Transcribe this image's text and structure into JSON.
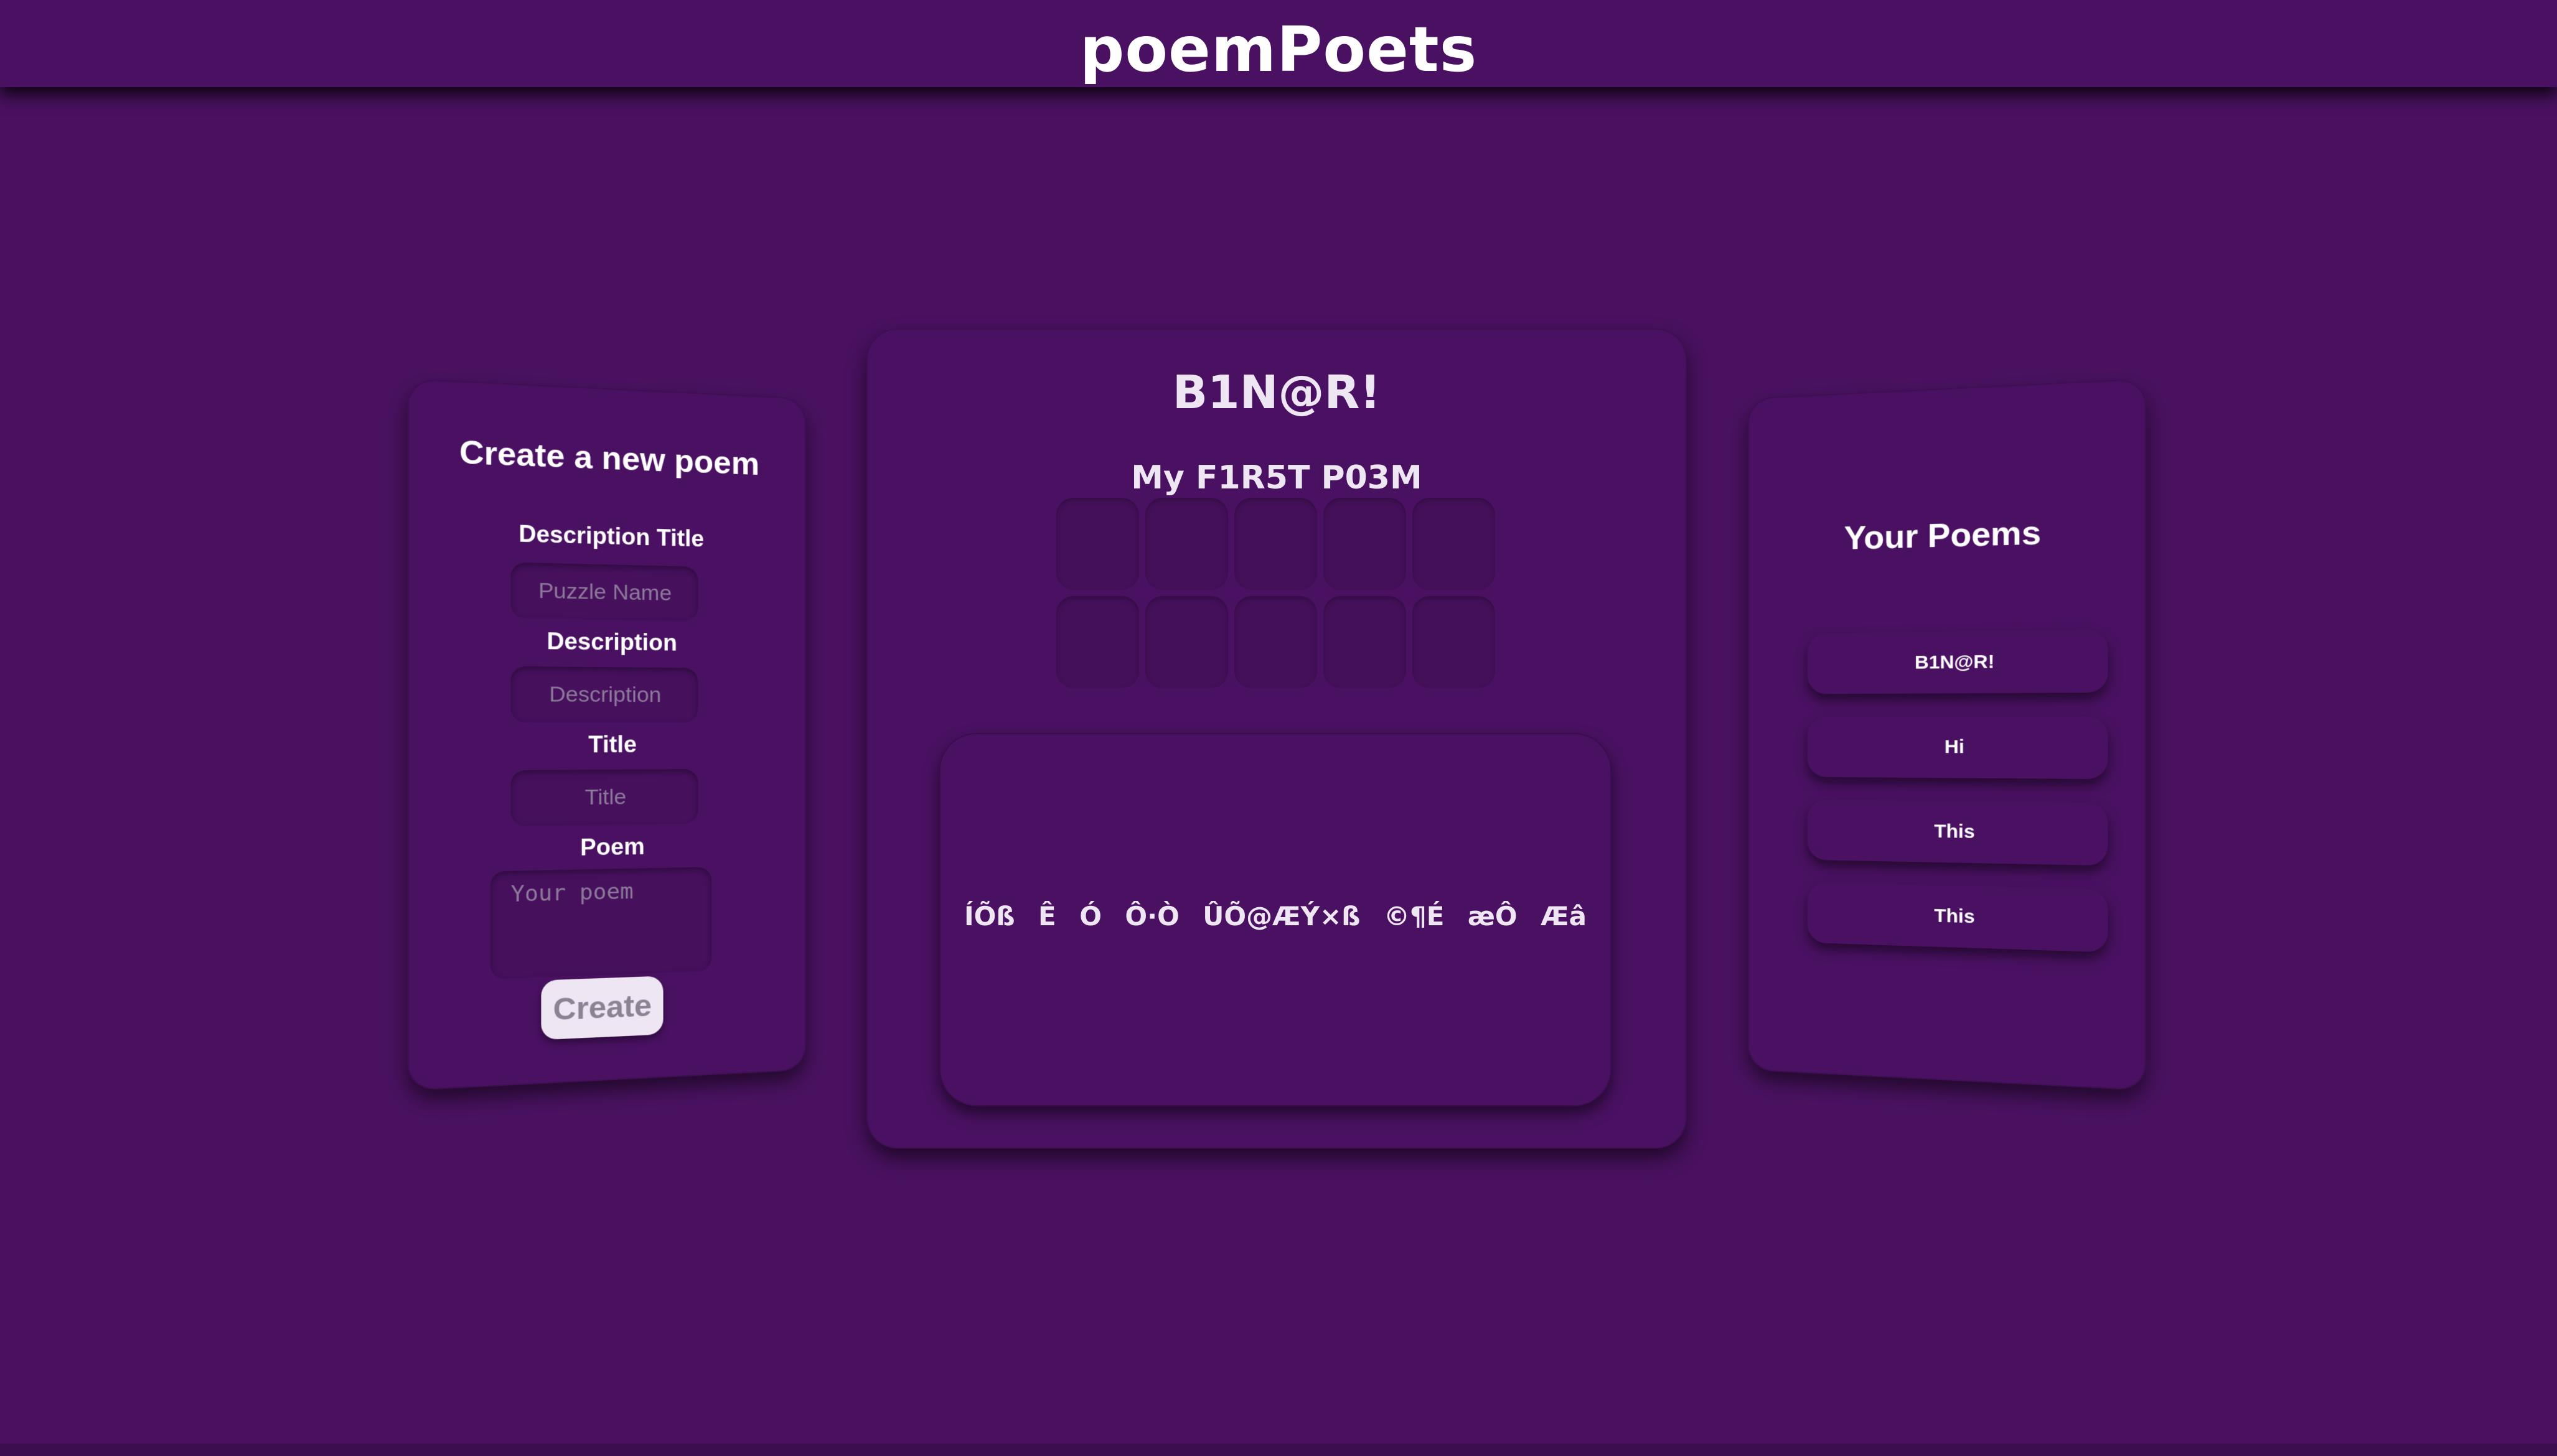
{
  "app": {
    "title": "poemPoets"
  },
  "create_form": {
    "heading": "Create a new poem",
    "description_title_label": "Description Title",
    "description_title_placeholder": "Puzzle Name",
    "description_label": "Description",
    "description_placeholder": "Description",
    "title_label": "Title",
    "title_placeholder": "Title",
    "poem_label": "Poem",
    "poem_placeholder": "Your poem",
    "create_button": "Create"
  },
  "puzzle": {
    "title": "B1N@R!",
    "description": "My F1R5T P03M",
    "grid_rows": 2,
    "grid_cols": 5,
    "poem_words": [
      "ÍÕß",
      "Ê",
      "Ó",
      "Ô·Ò",
      "ÛÕ@ÆÝ×ß",
      "©¶É",
      "æÔ",
      "Æâ"
    ]
  },
  "your_poems": {
    "heading": "Your Poems",
    "items": [
      "B1N@R!",
      "Hi",
      "This",
      "This"
    ]
  },
  "colors": {
    "background": "#491160",
    "panel": "#4a1162",
    "cell": "#45105a",
    "button_bg": "#efe6f3"
  }
}
